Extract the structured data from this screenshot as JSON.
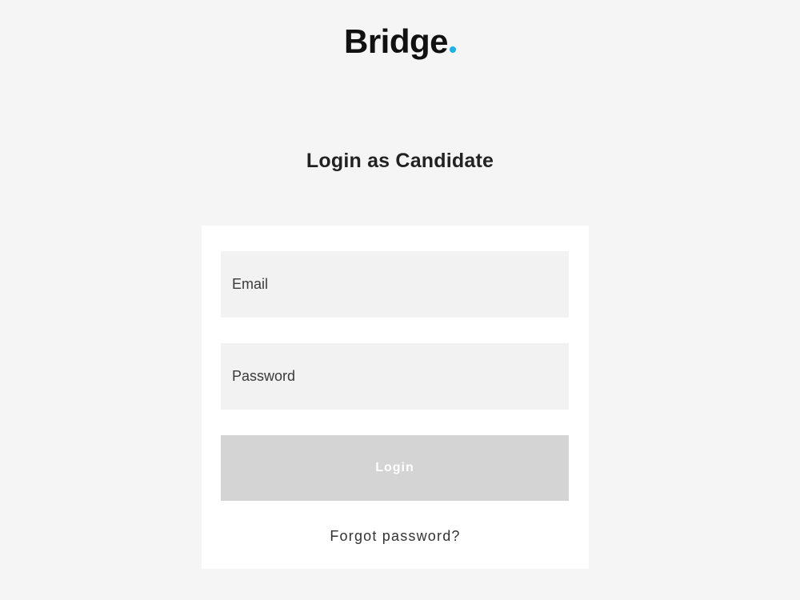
{
  "brand": {
    "name": "Bridge",
    "dot_color": "#1ab3e6"
  },
  "page": {
    "title": "Login as Candidate"
  },
  "form": {
    "email_placeholder": "Email",
    "password_placeholder": "Password",
    "login_label": "Login",
    "forgot_label": "Forgot password?",
    "login_button_color": "#d4d4d4"
  }
}
